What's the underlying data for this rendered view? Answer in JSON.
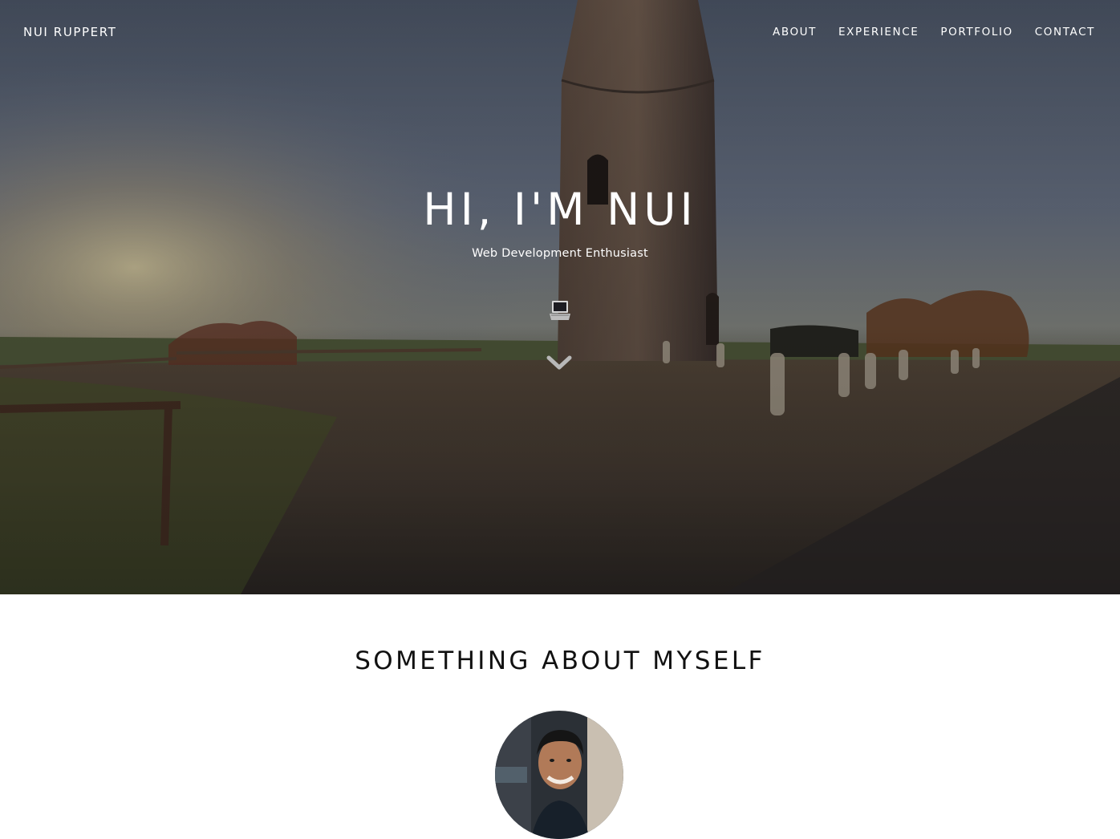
{
  "nav": {
    "brand": "NUI RUPPERT",
    "links": [
      {
        "label": "ABOUT"
      },
      {
        "label": "EXPERIENCE"
      },
      {
        "label": "PORTFOLIO"
      },
      {
        "label": "CONTACT"
      }
    ]
  },
  "hero": {
    "title": "HI, I'M NUI",
    "subtitle": "Web Development Enthusiast",
    "icons": [
      "laptop-icon",
      "chevron-down-icon"
    ]
  },
  "about": {
    "title": "SOMETHING ABOUT MYSELF"
  },
  "colors": {
    "text_light": "#ffffff",
    "text_dark": "#111111",
    "section_bg": "#ffffff"
  }
}
